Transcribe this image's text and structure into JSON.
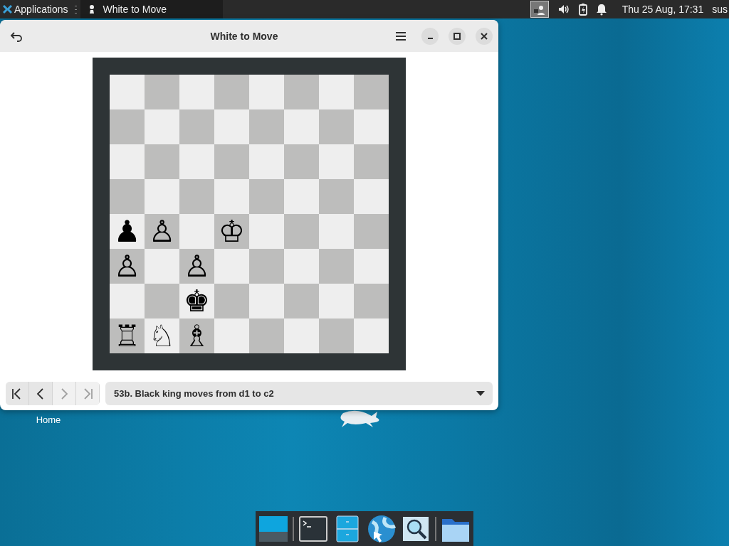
{
  "top_panel": {
    "menu_label": "Applications",
    "task": {
      "title": "White to Move",
      "selected": true
    },
    "clock": "Thu 25 Aug, 17:31",
    "user": "sus"
  },
  "window": {
    "title": "White to Move",
    "board": {
      "rows": [
        [
          {
            "dark": false
          },
          {
            "dark": true
          },
          {
            "dark": false
          },
          {
            "dark": true
          },
          {
            "dark": false
          },
          {
            "dark": true
          },
          {
            "dark": false
          },
          {
            "dark": true
          }
        ],
        [
          {
            "dark": true
          },
          {
            "dark": false
          },
          {
            "dark": true
          },
          {
            "dark": false
          },
          {
            "dark": true
          },
          {
            "dark": false
          },
          {
            "dark": true
          },
          {
            "dark": false
          }
        ],
        [
          {
            "dark": false
          },
          {
            "dark": true
          },
          {
            "dark": false
          },
          {
            "dark": true
          },
          {
            "dark": false
          },
          {
            "dark": true
          },
          {
            "dark": false
          },
          {
            "dark": true
          }
        ],
        [
          {
            "dark": true
          },
          {
            "dark": false
          },
          {
            "dark": true
          },
          {
            "dark": false
          },
          {
            "dark": true
          },
          {
            "dark": false
          },
          {
            "dark": true
          },
          {
            "dark": false
          }
        ],
        [
          {
            "dark": false,
            "piece": "♟"
          },
          {
            "dark": true,
            "piece": "♙"
          },
          {
            "dark": false
          },
          {
            "dark": true,
            "piece": "♔"
          },
          {
            "dark": false
          },
          {
            "dark": true
          },
          {
            "dark": false
          },
          {
            "dark": true
          }
        ],
        [
          {
            "dark": true,
            "piece": "♙"
          },
          {
            "dark": false
          },
          {
            "dark": true,
            "piece": "♙"
          },
          {
            "dark": false
          },
          {
            "dark": true
          },
          {
            "dark": false
          },
          {
            "dark": true
          },
          {
            "dark": false
          }
        ],
        [
          {
            "dark": false
          },
          {
            "dark": true
          },
          {
            "dark": false,
            "piece": "♚"
          },
          {
            "dark": true
          },
          {
            "dark": false
          },
          {
            "dark": true
          },
          {
            "dark": false
          },
          {
            "dark": true
          }
        ],
        [
          {
            "dark": true,
            "piece": "♖"
          },
          {
            "dark": false,
            "piece": "♘"
          },
          {
            "dark": true,
            "piece": "♗"
          },
          {
            "dark": false
          },
          {
            "dark": true
          },
          {
            "dark": false
          },
          {
            "dark": true
          },
          {
            "dark": false
          }
        ]
      ]
    },
    "nav_buttons": [
      {
        "kind": "first",
        "disabled": false
      },
      {
        "kind": "previous",
        "disabled": false
      },
      {
        "kind": "next",
        "disabled": true
      },
      {
        "kind": "last",
        "disabled": true
      }
    ],
    "move_history": {
      "value": "53b. Black king moves from d1 to c2"
    }
  },
  "desktop": {
    "icons": [
      {
        "label": "Home"
      }
    ]
  }
}
